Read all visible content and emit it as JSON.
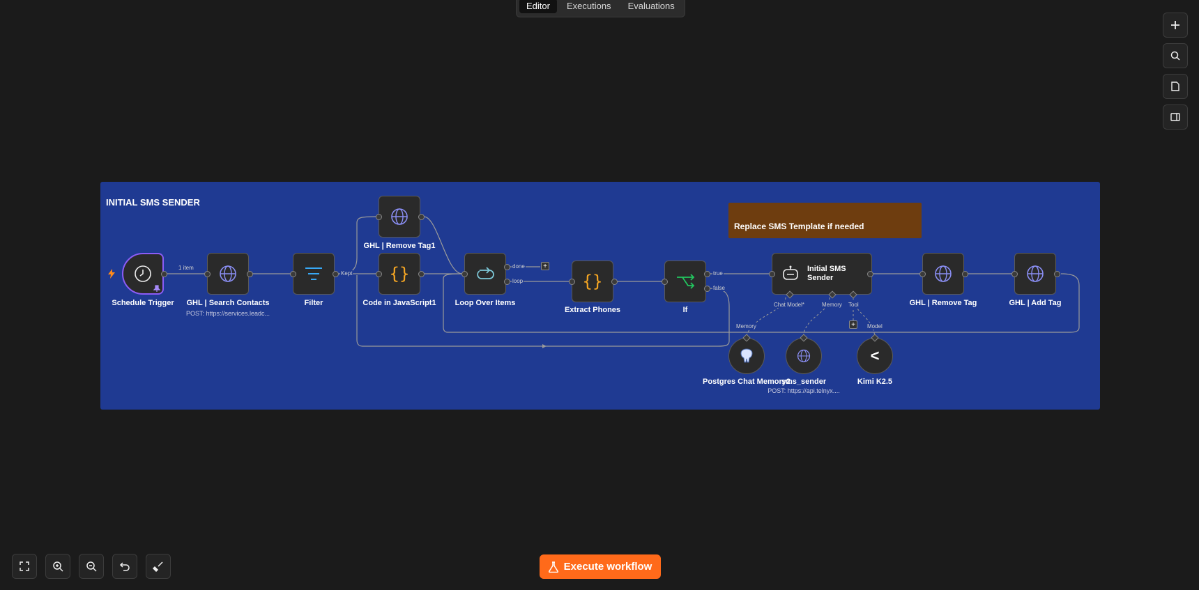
{
  "tabs": [
    "Editor",
    "Executions",
    "Evaluations"
  ],
  "sticky_main_title": "INITIAL SMS SENDER",
  "sticky_note_text": "Replace SMS Template if needed",
  "nodes": {
    "schedule": "Schedule Trigger",
    "search": "GHL | Search Contacts",
    "search_sub": "POST: https://services.leadc...",
    "filter": "Filter",
    "remove_tag1": "GHL | Remove Tag1",
    "code_js": "Code in JavaScript1",
    "loop": "Loop Over Items",
    "extract": "Extract Phones",
    "if": "If",
    "agent": "Initial SMS Sender",
    "remove_tag": "GHL | Remove Tag",
    "add_tag": "GHL | Add Tag",
    "postgres": "Postgres Chat Memory2",
    "sms": "sms_sender",
    "sms_sub": "POST: https://api.telnyx....",
    "kimi": "Kimi K2.5"
  },
  "edge_labels": {
    "items": "1 item",
    "kept": "Kept",
    "done": "done",
    "loop": "loop",
    "true": "true",
    "false": "false",
    "chat_model": "Chat Model*",
    "memory": "Memory",
    "tool": "Tool",
    "memory2": "Memory",
    "model": "Model"
  },
  "execute_label": "Execute workflow",
  "colors": {
    "accent": "#ff6a1a",
    "group": "#1f3a92",
    "note": "#6e3d0f"
  }
}
